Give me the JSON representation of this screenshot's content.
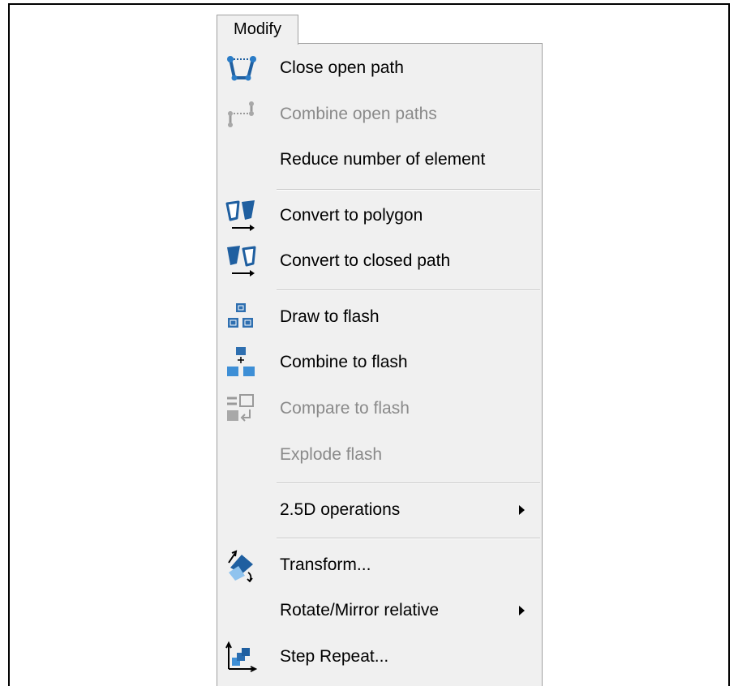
{
  "menu": {
    "title": "Modify",
    "items": [
      {
        "label": "Close open path",
        "icon": "close-path-icon",
        "enabled": true
      },
      {
        "label": "Combine open paths",
        "icon": "combine-paths-icon",
        "enabled": false
      },
      {
        "label": "Reduce number of element",
        "icon": "",
        "enabled": true
      },
      {
        "label": "Convert to polygon",
        "icon": "convert-polygon-icon",
        "enabled": true
      },
      {
        "label": "Convert to closed path",
        "icon": "convert-closed-path-icon",
        "enabled": true
      },
      {
        "label": "Draw to flash",
        "icon": "draw-flash-icon",
        "enabled": true
      },
      {
        "label": "Combine to flash",
        "icon": "combine-flash-icon",
        "enabled": true
      },
      {
        "label": "Compare to flash",
        "icon": "compare-flash-icon",
        "enabled": false
      },
      {
        "label": "Explode flash",
        "icon": "",
        "enabled": false
      },
      {
        "label": "2.5D operations",
        "icon": "",
        "enabled": true,
        "submenu": true
      },
      {
        "label": "Transform...",
        "icon": "transform-icon",
        "enabled": true
      },
      {
        "label": "Rotate/Mirror relative",
        "icon": "",
        "enabled": true,
        "submenu": true
      },
      {
        "label": "Step  Repeat...",
        "icon": "step-repeat-icon",
        "enabled": true
      }
    ]
  },
  "colors": {
    "menu_background": "#f0f0f0",
    "icon_blue": "#1f5fa0",
    "icon_blue_light": "#3e8fd6",
    "disabled_text": "#8a8a8a"
  }
}
